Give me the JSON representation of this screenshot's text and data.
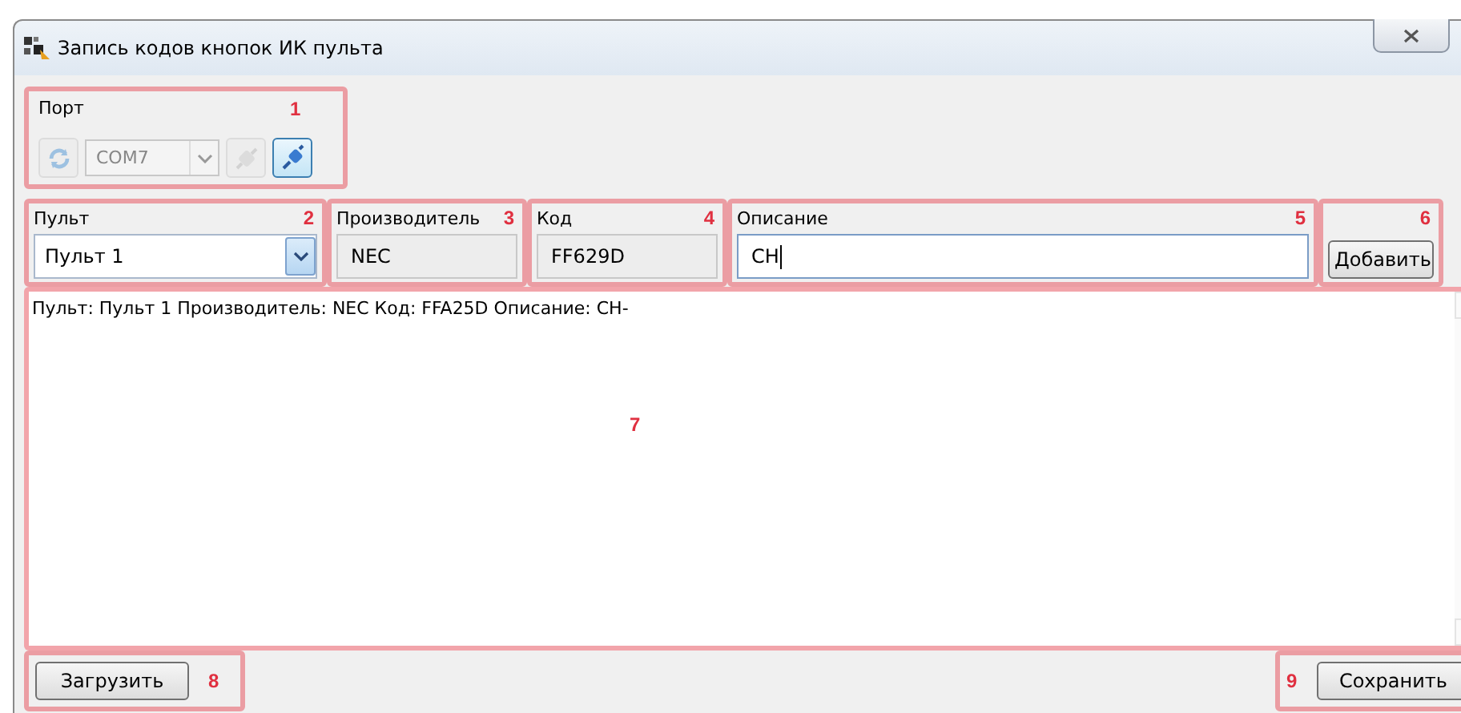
{
  "window": {
    "title": "Запись кодов кнопок ИК пульта"
  },
  "port": {
    "label": "Порт",
    "value": "COM7",
    "tools": [
      {
        "kind": "refresh",
        "disabled": true
      },
      {
        "kind": "combo",
        "disabled": true
      },
      {
        "kind": "disconnect",
        "disabled": true
      },
      {
        "kind": "connect",
        "disabled": false
      }
    ]
  },
  "fields": [
    {
      "kind": "combo",
      "label": "Пульт",
      "value": "Пульт 1"
    },
    {
      "kind": "readonly",
      "label": "Производитель",
      "value": "NEC"
    },
    {
      "kind": "readonly",
      "label": "Код",
      "value": "FF629D"
    },
    {
      "kind": "text",
      "label": "Описание",
      "value": "CH",
      "focused": true
    }
  ],
  "add_button": "Добавить",
  "log": [
    "Пульт: Пульт 1 Производитель: NEC Код: FFA25D Описание: CH-"
  ],
  "load_button": "Загрузить",
  "save_button": "Сохранить",
  "markers": [
    "1",
    "2",
    "3",
    "4",
    "5",
    "6",
    "7",
    "8",
    "9"
  ]
}
